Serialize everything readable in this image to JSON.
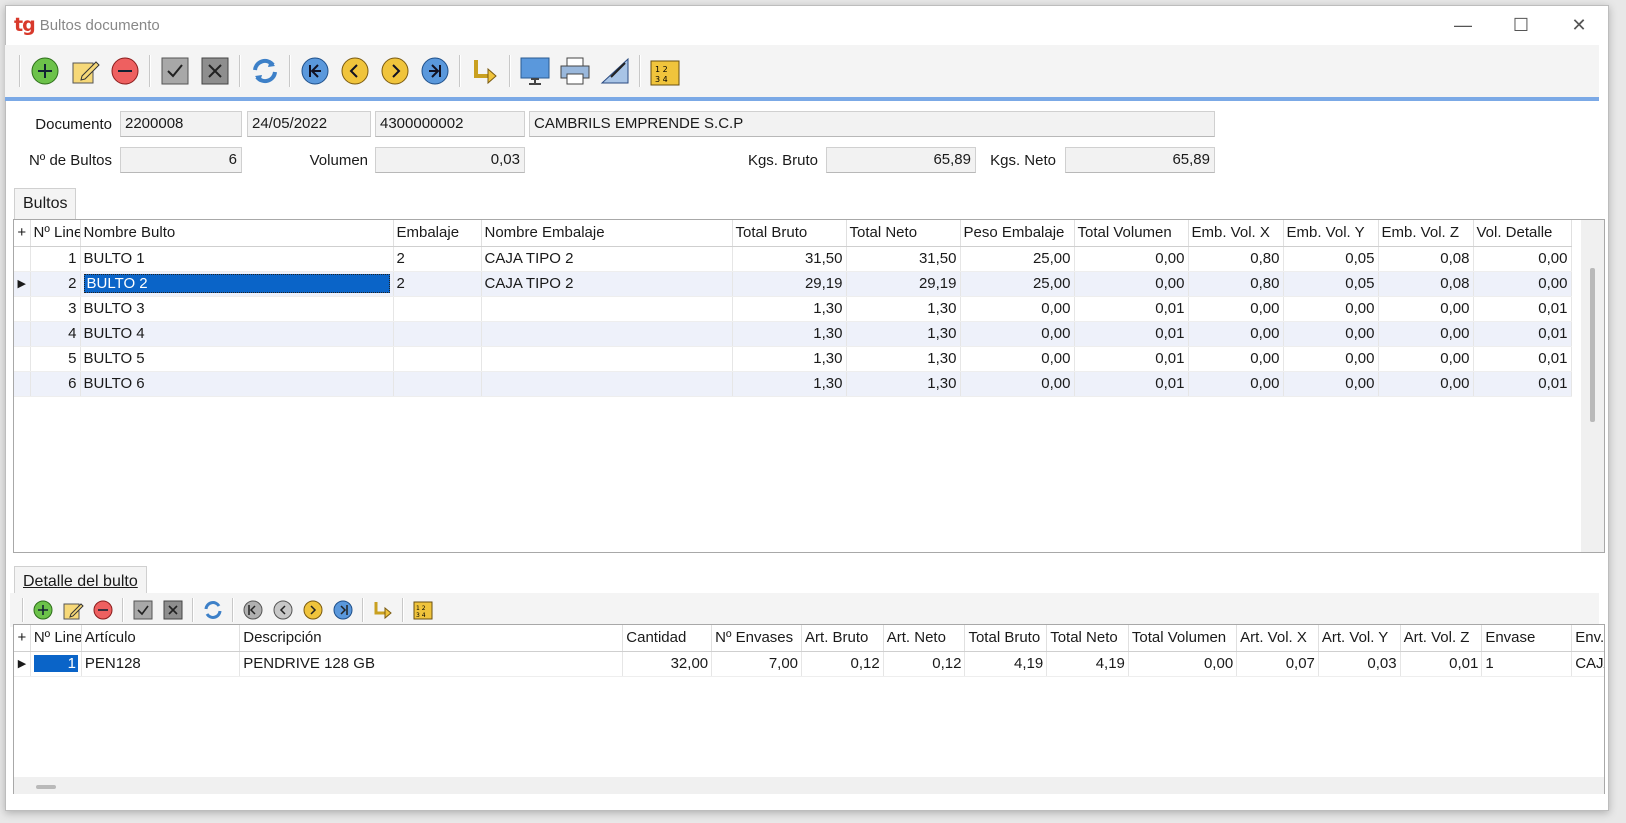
{
  "window": {
    "title": "Bultos documento",
    "logo": "tg"
  },
  "toolbar_main": [
    "add-icon",
    "edit-icon",
    "delete-icon",
    "confirm-icon",
    "cancel-icon",
    "refresh-icon",
    "first-icon",
    "previous-icon",
    "next-icon",
    "last-icon",
    "goto-icon",
    "monitor-icon",
    "print-icon",
    "export-icon",
    "numbering-icon"
  ],
  "header": {
    "documento_label": "Documento",
    "documento": "2200008",
    "fecha": "24/05/2022",
    "cliente_codigo": "4300000002",
    "cliente_nombre": "CAMBRILS EMPRENDE S.C.P",
    "bultos_label": "Nº de Bultos",
    "bultos": "6",
    "volumen_label": "Volumen",
    "volumen": "0,03",
    "kgs_bruto_label": "Kgs. Bruto",
    "kgs_bruto": "65,89",
    "kgs_neto_label": "Kgs. Neto",
    "kgs_neto": "65,89"
  },
  "bultos_tab": "Bultos",
  "bultos_grid": {
    "add_symbol": "+",
    "columns": [
      "Nº Line",
      "Nombre Bulto",
      "Embalaje",
      "Nombre Embalaje",
      "Total Bruto",
      "Total Neto",
      "Peso Embalaje",
      "Total Volumen",
      "Emb. Vol. X",
      "Emb. Vol. Y",
      "Emb. Vol. Z",
      "Vol. Detalle"
    ],
    "rows": [
      [
        "1",
        "BULTO 1",
        "2",
        "CAJA TIPO 2",
        "31,50",
        "31,50",
        "25,00",
        "0,00",
        "0,80",
        "0,05",
        "0,08",
        "0,00"
      ],
      [
        "2",
        "BULTO 2",
        "2",
        "CAJA TIPO 2",
        "29,19",
        "29,19",
        "25,00",
        "0,00",
        "0,80",
        "0,05",
        "0,08",
        "0,00"
      ],
      [
        "3",
        "BULTO 3",
        "",
        "",
        "1,30",
        "1,30",
        "0,00",
        "0,01",
        "0,00",
        "0,00",
        "0,00",
        "0,01"
      ],
      [
        "4",
        "BULTO 4",
        "",
        "",
        "1,30",
        "1,30",
        "0,00",
        "0,01",
        "0,00",
        "0,00",
        "0,00",
        "0,01"
      ],
      [
        "5",
        "BULTO 5",
        "",
        "",
        "1,30",
        "1,30",
        "0,00",
        "0,01",
        "0,00",
        "0,00",
        "0,00",
        "0,01"
      ],
      [
        "6",
        "BULTO 6",
        "",
        "",
        "1,30",
        "1,30",
        "0,00",
        "0,01",
        "0,00",
        "0,00",
        "0,00",
        "0,01"
      ]
    ],
    "selected_row": 1
  },
  "detalle_tab": "Detalle del bulto",
  "detalle_grid": {
    "add_symbol": "+",
    "columns": [
      "Nº Line",
      "Artículo",
      "Descripción",
      "Cantidad",
      "Nº Envases",
      "Art. Bruto",
      "Art. Neto",
      "Total Bruto",
      "Total Neto",
      "Total Volumen",
      "Art. Vol. X",
      "Art. Vol. Y",
      "Art. Vol. Z",
      "Envase",
      "Env. No"
    ],
    "rows": [
      [
        "1",
        "PEN128",
        "PENDRIVE 128 GB",
        "32,00",
        "7,00",
        "0,12",
        "0,12",
        "4,19",
        "4,19",
        "0,00",
        "0,07",
        "0,03",
        "0,01",
        "1",
        "CAJA D"
      ]
    ]
  },
  "colors": {
    "accent": "#0a64c8",
    "line": "#7ba9e6",
    "logo": "#d8392b"
  }
}
